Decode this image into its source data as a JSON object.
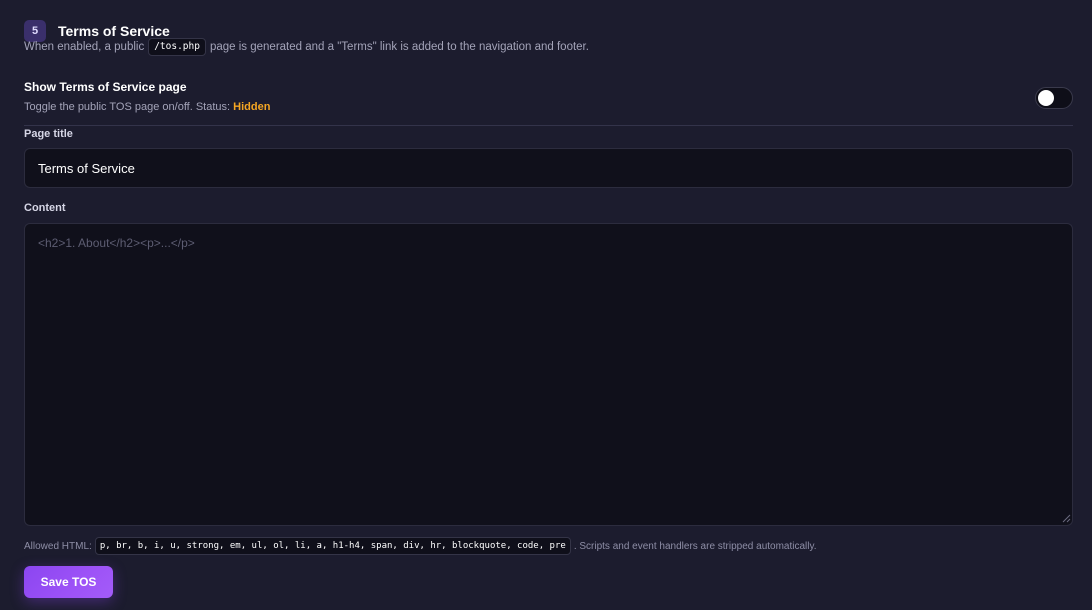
{
  "section": {
    "step_number": "5",
    "title": "Terms of Service",
    "description_before": "When enabled, a public",
    "description_code": "/tos.php",
    "description_after": "page is generated and a \"Terms\" link is added to the navigation and footer."
  },
  "toggle": {
    "title": "Show Terms of Service page",
    "description": "Toggle the public TOS page on/off. Status:",
    "status": "Hidden",
    "enabled": false,
    "status_color": "#f5a623"
  },
  "page_title_field": {
    "label": "Page title",
    "value": "Terms of Service"
  },
  "content_field": {
    "label": "Content",
    "value": "",
    "placeholder": "<h2>1. About</h2><p>...</p>"
  },
  "allowed_html": {
    "prefix": "Allowed HTML:",
    "tags": "p, br, b, i, u, strong, em, ul, ol, li, a, h1-h4, span, div, hr, blockquote, code, pre",
    "suffix": ". Scripts and event handlers are stripped automatically."
  },
  "save_button": {
    "label": "Save TOS",
    "color": "#8b46f0"
  }
}
